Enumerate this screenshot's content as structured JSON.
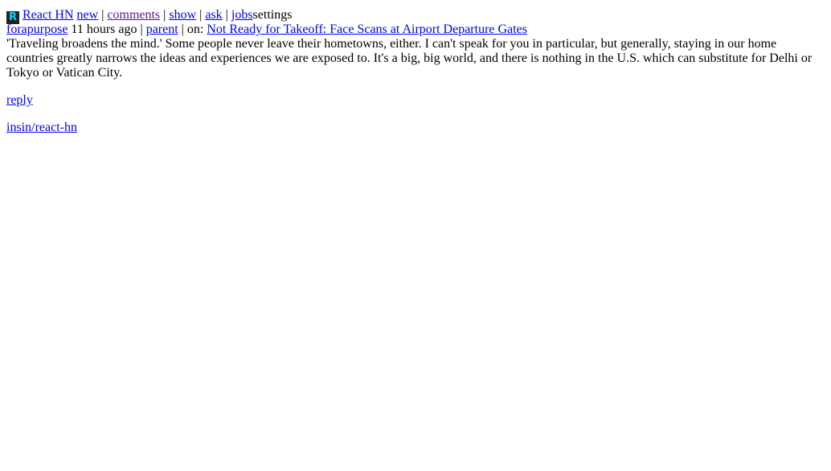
{
  "header": {
    "logo_letter": "R",
    "brand": "React HN",
    "nav": {
      "new": "new",
      "comments": "comments",
      "show": "show",
      "ask": "ask",
      "jobs": "jobs",
      "settings": "settings"
    },
    "separator": " | "
  },
  "comment": {
    "author": "forapurpose",
    "age": "11 hours ago",
    "parent_label": "parent",
    "on_label": "on:",
    "story_title": "Not Ready for Takeoff: Face Scans at Airport Departure Gates",
    "text": "'Traveling broadens the mind.' Some people never leave their hometowns, either. I can't speak for you in particular, but generally, staying in our home countries greatly narrows the ideas and experiences we are exposed to. It's a big, big world, and there is nothing in the U.S. which can substitute for Delhi or Tokyo or Vatican City.",
    "reply_label": "reply"
  },
  "footer": {
    "repo_link": "insin/react-hn"
  }
}
